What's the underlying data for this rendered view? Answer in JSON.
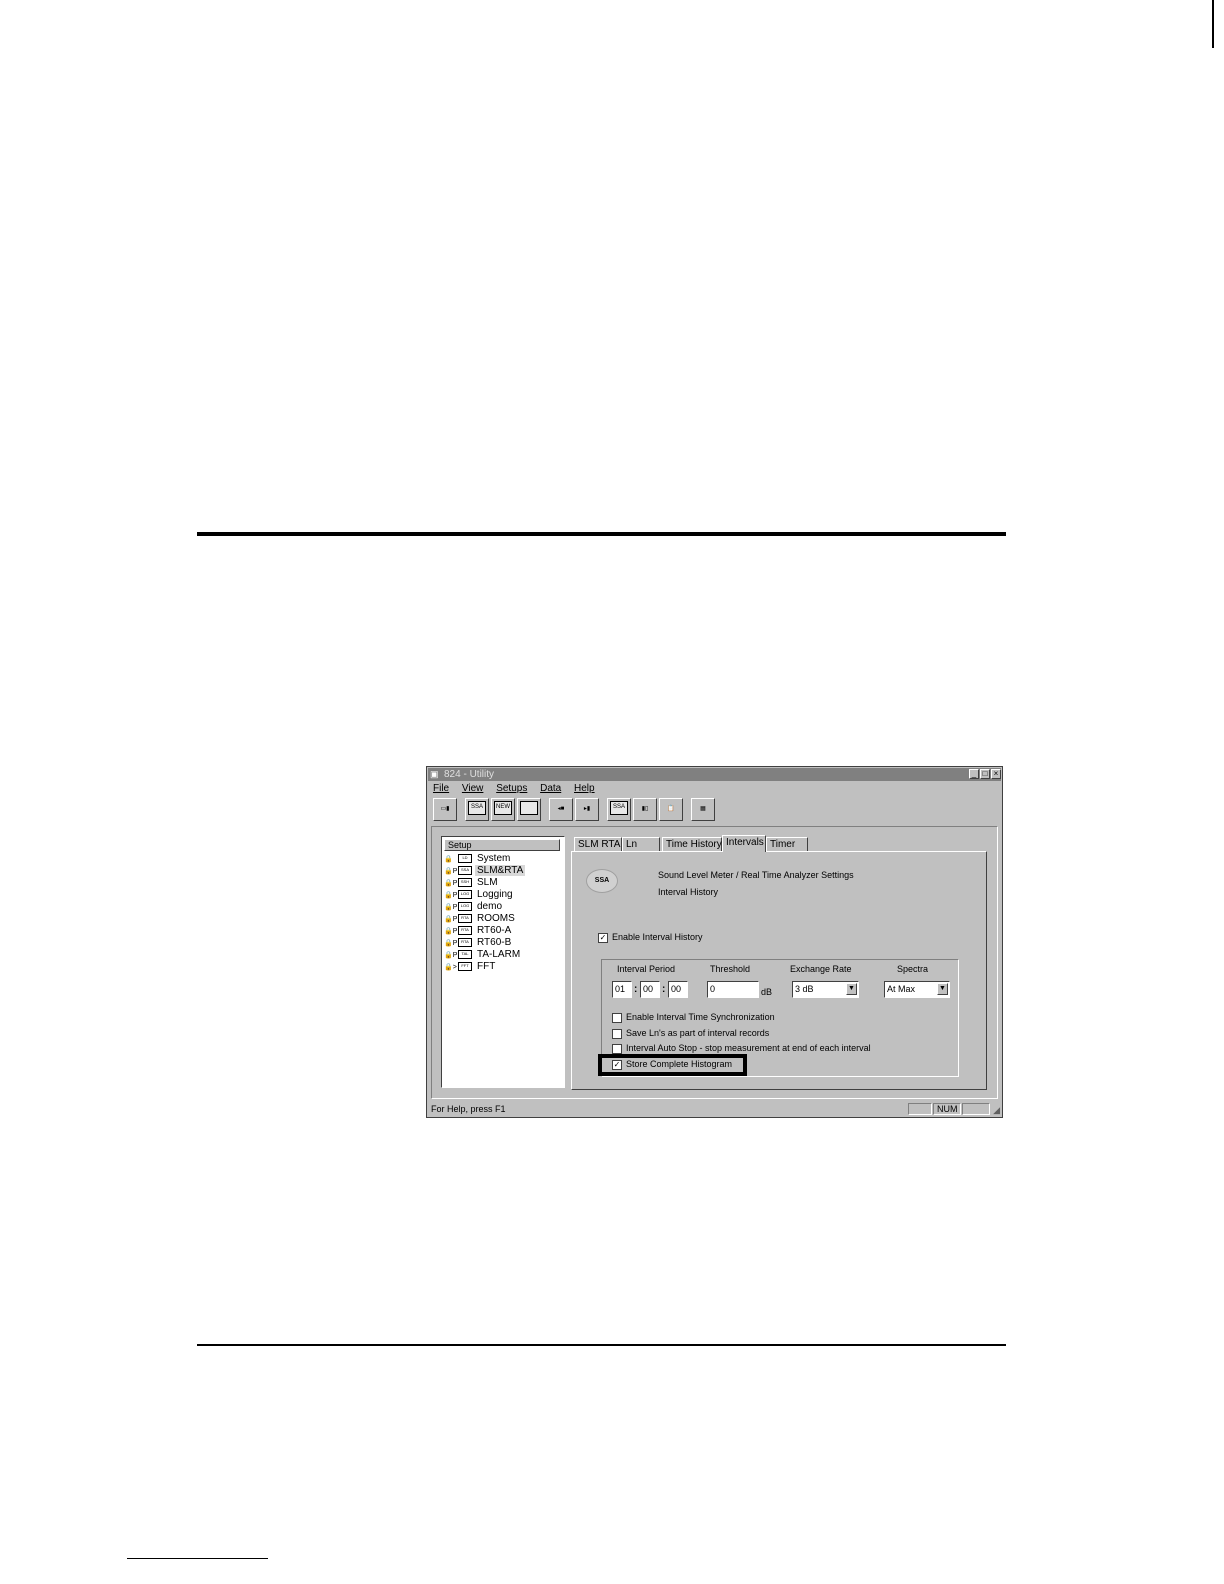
{
  "window": {
    "title": "824 - Utility",
    "min_glyph": "_",
    "max_glyph": "□",
    "close_glyph": "×"
  },
  "menu": [
    "File",
    "View",
    "Setups",
    "Data",
    "Help"
  ],
  "toolbar": {
    "buttons": [
      "send-setup",
      "ssa",
      "ssa-new",
      "rta",
      "save",
      "slm-meter",
      "ssa-active",
      "meter-data",
      "clipboard",
      "grid"
    ],
    "button_labels": {
      "ssa": "SSA",
      "ssa_new": "NEW",
      "ssa_active": "SSA"
    }
  },
  "tree": {
    "header": "Setup",
    "items": [
      {
        "badge": "LD",
        "label": "System",
        "lock": "🔒"
      },
      {
        "badge": "SSA",
        "label": "SLM&RTA",
        "lock": "🔒P",
        "selected": true
      },
      {
        "badge": "SSH",
        "label": "SLM",
        "lock": "🔒P"
      },
      {
        "badge": "LOG",
        "label": "Logging",
        "lock": "🔒P"
      },
      {
        "badge": "LOG",
        "label": "demo",
        "lock": "🔒P"
      },
      {
        "badge": "RTA",
        "label": "ROOMS",
        "lock": "🔒P"
      },
      {
        "badge": "RTA",
        "label": "RT60-A",
        "lock": "🔒P"
      },
      {
        "badge": "RTA",
        "label": "RT60-B",
        "lock": "🔒P"
      },
      {
        "badge": "TAL",
        "label": "TA-LARM",
        "lock": "🔒P"
      },
      {
        "badge": "FFT",
        "label": "FFT",
        "lock": "🔒>"
      }
    ]
  },
  "tabs": [
    "SLM RTA",
    "Ln",
    "Time History",
    "Intervals",
    "Timer"
  ],
  "active_tab": "Intervals",
  "panel": {
    "icon_text": "SSA",
    "heading": "Sound Level Meter / Real Time Analyzer Settings",
    "subheading": "Interval History",
    "enable_label": "Enable Interval History",
    "enable_checked": "✓",
    "labels": {
      "interval_period": "Interval Period",
      "threshold": "Threshold",
      "exchange_rate": "Exchange Rate",
      "spectra": "Spectra"
    },
    "interval_hh": "01",
    "interval_mm": "00",
    "interval_ss": "00",
    "sep": ":",
    "threshold_value": "0",
    "threshold_unit": "dB",
    "exchange_rate_value": "3 dB",
    "spectra_value": "At Max",
    "combo_arrow": "▼",
    "options": [
      {
        "label": "Enable Interval Time Synchronization",
        "checked": ""
      },
      {
        "label": "Save Ln's as part of interval records",
        "checked": ""
      },
      {
        "label": "Interval Auto Stop - stop measurement at end of each interval",
        "checked": ""
      },
      {
        "label": "Store Complete Histogram",
        "checked": "✓"
      }
    ]
  },
  "status": {
    "help_text": "For Help, press F1",
    "num": "NUM"
  }
}
